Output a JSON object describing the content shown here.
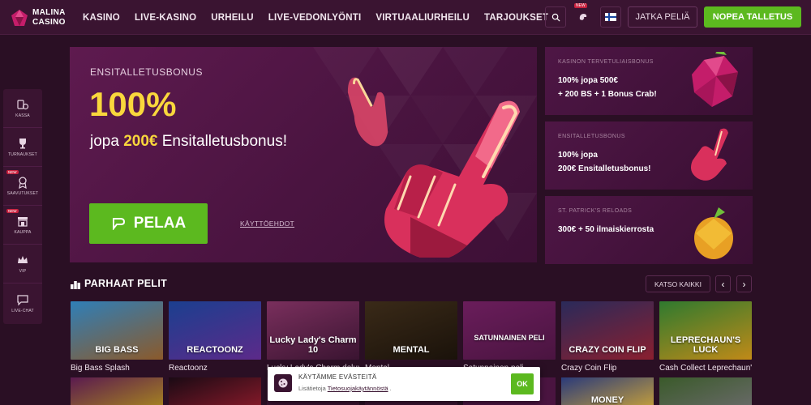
{
  "brand": {
    "line1": "MALINA",
    "line2": "CASINO"
  },
  "nav": {
    "items": [
      "KASINO",
      "LIVE-KASINO",
      "URHEILU",
      "LIVE-VEDONLYÖNTI",
      "VIRTUAALIURHEILU",
      "TARJOUKSET"
    ]
  },
  "header": {
    "continue_label": "JATKA PELIÄ",
    "deposit_label": "NOPEA TALLETUS",
    "new_badge": "NEW"
  },
  "sidebar": {
    "items": [
      {
        "label": "KASSA",
        "icon": "coins-icon"
      },
      {
        "label": "TURNAUKSET",
        "icon": "trophy-icon"
      },
      {
        "label": "SAAVUTUKSET",
        "icon": "medal-icon",
        "badge": "NEW"
      },
      {
        "label": "KAUPPA",
        "icon": "shop-icon",
        "badge": "NEW"
      },
      {
        "label": "VIP",
        "icon": "crown-icon"
      },
      {
        "label": "LIVE-CHAT",
        "icon": "chat-icon"
      }
    ]
  },
  "hero": {
    "subtitle": "ENSITALLETUSBONUS",
    "big": "100%",
    "line_pre": "jopa ",
    "line_hl": "200€",
    "line_post": " Ensitalletusbonus!",
    "cta": "PELAA",
    "terms": "KÄYTTÖEHDOT"
  },
  "promos": [
    {
      "tag": "KASINON TERVETULIAISBONUS",
      "lines": [
        "100% jopa 500€",
        "+ 200 BS + 1 Bonus Crab!"
      ]
    },
    {
      "tag": "ENSITALLETUSBONUS",
      "lines": [
        "100% jopa",
        "200€ Ensitalletusbonus!"
      ]
    },
    {
      "tag": "ST. PATRICK'S RELOADS",
      "lines": [
        "300€ + 50 ilmaiskierrosta"
      ]
    }
  ],
  "section": {
    "title": "PARHAAT PELIT",
    "see_all": "KATSO KAIKKI"
  },
  "games": [
    {
      "name": "Big Bass Splash",
      "art": "BIG BASS",
      "bg1": "#2f7fb8",
      "bg2": "#8b5a2b"
    },
    {
      "name": "Reactoonz",
      "art": "REACTOONZ",
      "bg1": "#1b3f8f",
      "bg2": "#5c2a8a"
    },
    {
      "name": "Lucky Lady's Charm deluxe",
      "art": "Lucky Lady's Charm 10",
      "bg1": "#7a2f5d",
      "bg2": "#3a1431"
    },
    {
      "name": "Mental",
      "art": "MENTAL",
      "bg1": "#3a2a18",
      "bg2": "#1a120a"
    },
    {
      "name": "Satunnainen peli",
      "art": "SATUNNAINEN PELI",
      "bg1": "#6a1d5b",
      "bg2": "#4a1440"
    },
    {
      "name": "Crazy Coin Flip",
      "art": "CRAZY COIN FLIP",
      "bg1": "#2a2a5a",
      "bg2": "#8a1f2f"
    },
    {
      "name": "Cash Collect Leprechaun's Luck",
      "art": "LEPRECHAUN'S LUCK",
      "bg1": "#2f7a2f",
      "bg2": "#c08a18"
    }
  ],
  "row2": [
    {
      "bg1": "#5a1a4f",
      "bg2": "#a8871f"
    },
    {
      "bg1": "#1a0a14",
      "bg2": "#8a1a2a"
    },
    {
      "bg1": "#3a1431",
      "bg2": "#3a1431"
    },
    {
      "bg1": "#3a1431",
      "bg2": "#3a1431"
    },
    {
      "bg1": "#4a1440",
      "bg2": "#4a1440"
    },
    {
      "bg1": "#2a3a7a",
      "bg2": "#c9a23a",
      "art": "MONEY"
    },
    {
      "bg1": "#3a5a2a",
      "bg2": "#6a6a6a"
    }
  ],
  "cookie": {
    "title": "KÄYTÄMME EVÄSTEITÄ",
    "info_pre": "Lisätietoja ",
    "link": "Tietosuojakäytännöstä",
    "info_post": " .",
    "ok": "OK"
  },
  "colors": {
    "accent_green": "#5cb91f",
    "gold": "#f9d73c",
    "bg": "#2a0f24"
  }
}
